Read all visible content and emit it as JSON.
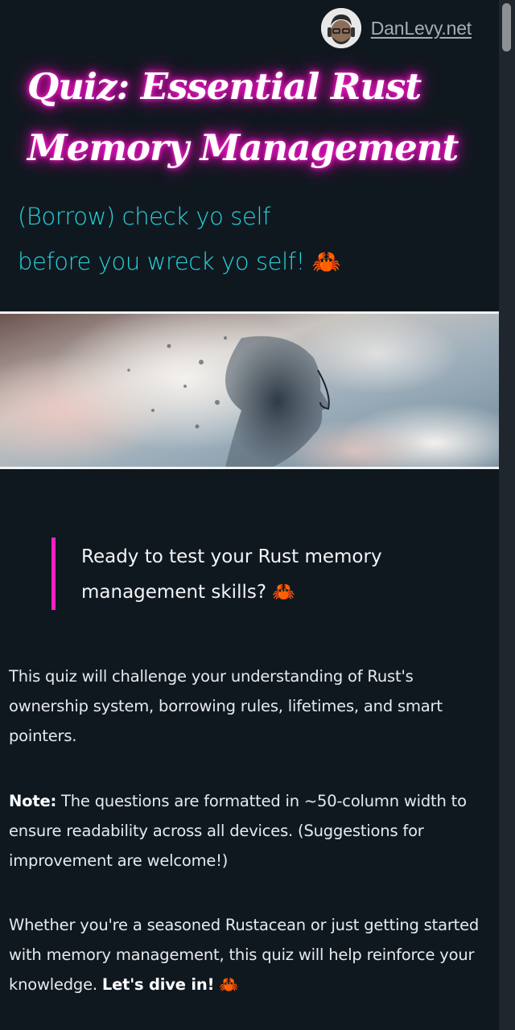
{
  "header": {
    "site_link": "DanLevy.net"
  },
  "title": {
    "line1": "Quiz: Essential Rust",
    "line2": "Memory Management"
  },
  "subtitle": {
    "line1": "(Borrow) check yo self",
    "line2": "before you wreck yo self!",
    "emoji": "🦀"
  },
  "quote": {
    "text": "Ready to test your Rust memory management skills?",
    "emoji": "🦀"
  },
  "intro": {
    "paragraph1": "This quiz will challenge your understanding of Rust's ownership system, borrowing rules, lifetimes, and smart pointers.",
    "note_label": "Note:",
    "note_text": " The questions are formatted in ~50-column width to ensure readability across all devices. (Suggestions for improvement are welcome!)",
    "paragraph3": "Whether you're a seasoned Rustacean or just getting started with memory management, this quiz will help reinforce your knowledge. ",
    "cta": "Let's dive in!",
    "cta_emoji": "🦀"
  },
  "colors": {
    "background": "#10181f",
    "title_glow": "#ff00cc",
    "subtitle": "#26d4dc",
    "quote_border": "#ff1fc4"
  },
  "icons": {
    "avatar": "author-avatar",
    "emoji": "crab-emoji"
  }
}
